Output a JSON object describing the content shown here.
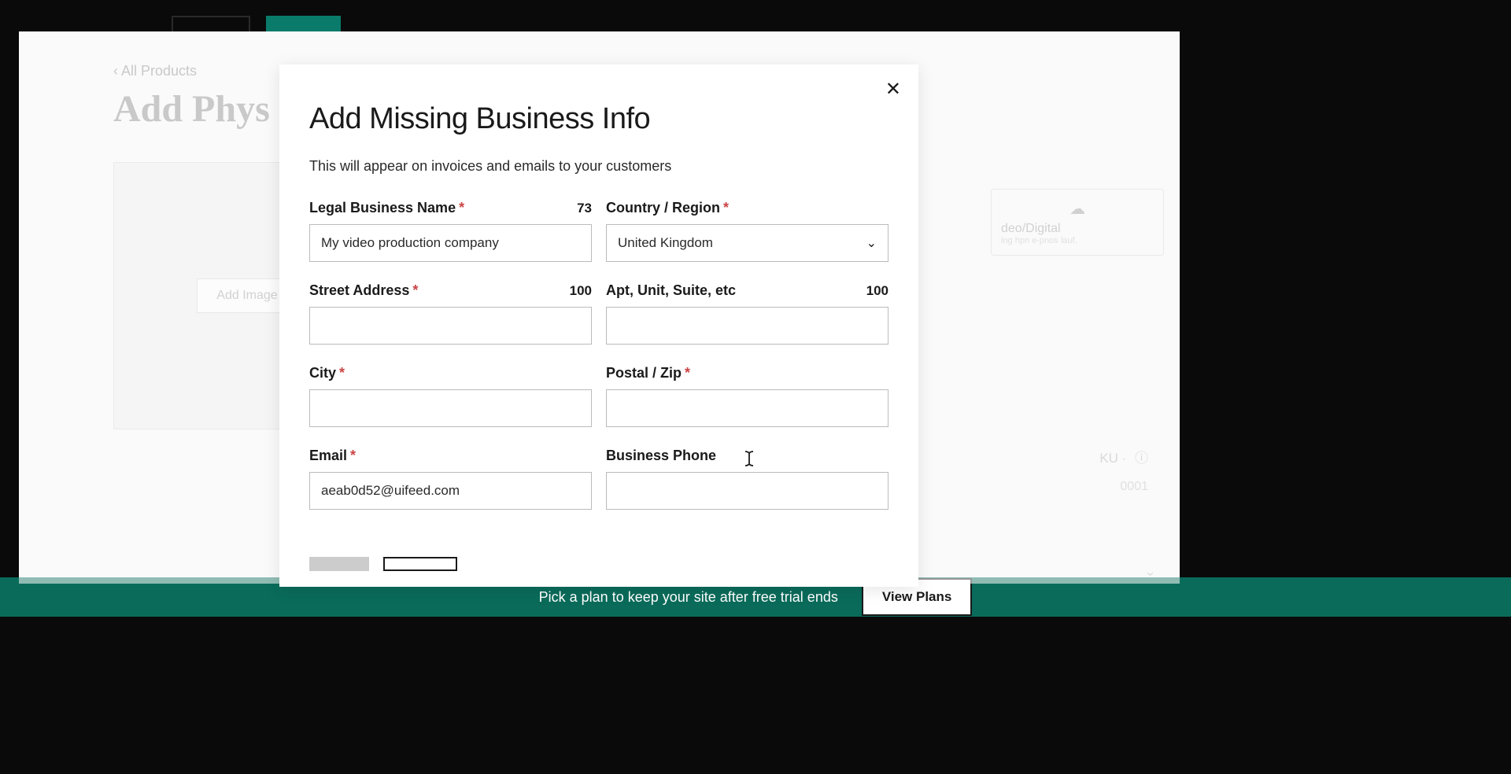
{
  "background": {
    "breadcrumb": "‹ All Products",
    "page_title": "Add Phys",
    "add_images_label": "Add Image",
    "digital_card": {
      "title": "deo/Digital",
      "description": "ing  hpn  e-pnos  lauf."
    },
    "sku_label": "KU ·",
    "sku_value": "0001",
    "trial_text": "Pick a plan to keep your site after free trial ends",
    "view_plans_label": "View Plans"
  },
  "modal": {
    "title": "Add Missing Business Info",
    "subtitle": "This will appear on invoices and emails to your customers",
    "fields": {
      "legal_name": {
        "label": "Legal Business Name",
        "required": true,
        "char_count": "73",
        "value": "My video production company"
      },
      "country": {
        "label": "Country / Region",
        "required": true,
        "value": "United Kingdom"
      },
      "street": {
        "label": "Street Address",
        "required": true,
        "char_count": "100",
        "value": ""
      },
      "apt": {
        "label": "Apt, Unit, Suite, etc",
        "required": false,
        "char_count": "100",
        "value": ""
      },
      "city": {
        "label": "City",
        "required": true,
        "value": ""
      },
      "postal": {
        "label": "Postal / Zip",
        "required": true,
        "value": ""
      },
      "email": {
        "label": "Email",
        "required": true,
        "value": "aeab0d52@uifeed.com"
      },
      "phone": {
        "label": "Business Phone",
        "required": false,
        "value": ""
      }
    }
  }
}
